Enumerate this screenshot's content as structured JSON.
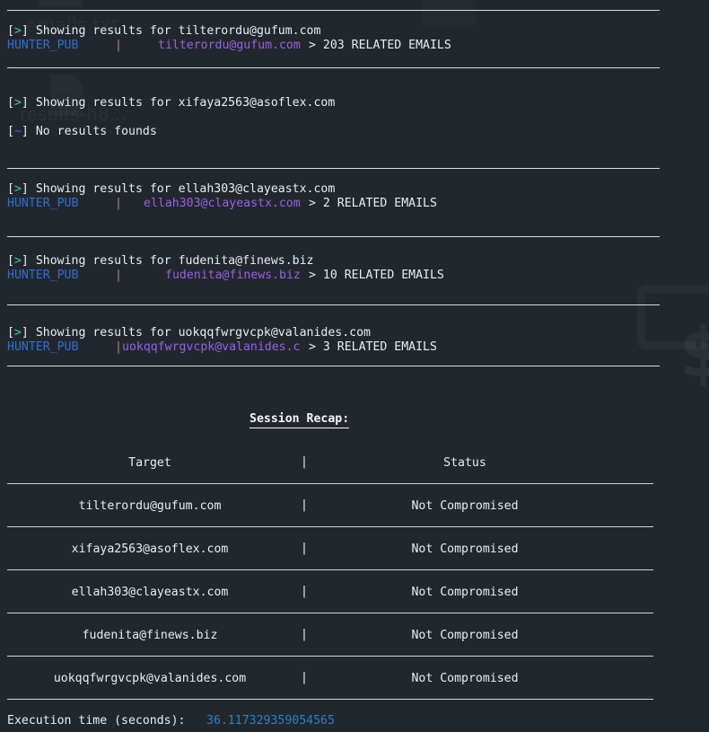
{
  "terminal": {
    "background_color": "#22272e",
    "foreground_color": "#e9edf2",
    "accent_green": "#2fce9f",
    "accent_blue": "#2f6fd0",
    "accent_purple": "#9a5fe2",
    "accent_lightblue": "#2583c6",
    "rule_color": "#d8dde5"
  },
  "watermarks": {
    "file_label_top": "emails.txt",
    "file_label_mid": "results-h8...",
    "dollar_glyph": "$"
  },
  "prompts": {
    "result_marker_open": "[",
    "result_marker_arrow": ">",
    "result_marker_close": "]",
    "empty_marker_open": "[",
    "empty_marker_tilde": "~",
    "empty_marker_close": "]",
    "showing_prefix": "Showing results for ",
    "no_results": "No results founds",
    "source_label": "HUNTER_PUB",
    "divider": "|",
    "gt": ">",
    "related_suffix": "RELATED EMAILS"
  },
  "results": [
    {
      "target": "tilterordu@gufum.com",
      "source": "HUNTER_PUB",
      "email_display": "tilterordu@gufum.com",
      "count": "203",
      "related_text": "> 203 RELATED EMAILS",
      "found": true
    },
    {
      "target": "xifaya2563@asoflex.com",
      "source": "",
      "email_display": "",
      "count": "0",
      "related_text": "",
      "found": false
    },
    {
      "target": "ellah303@clayeastx.com",
      "source": "HUNTER_PUB",
      "email_display": "ellah303@clayeastx.com",
      "count": "2",
      "related_text": "> 2 RELATED EMAILS",
      "found": true
    },
    {
      "target": "fudenita@finews.biz",
      "source": "HUNTER_PUB",
      "email_display": "fudenita@finews.biz",
      "count": "10",
      "related_text": "> 10 RELATED EMAILS",
      "found": true
    },
    {
      "target": "uokqqfwrgvcpk@valanides.com",
      "source": "HUNTER_PUB",
      "email_display": "uokqqfwrgvcpk@valanides.c",
      "count": "3",
      "related_text": "> 3 RELATED EMAILS",
      "found": true
    }
  ],
  "recap": {
    "title": "Session Recap:",
    "columns": [
      "Target",
      "Status"
    ],
    "column_divider": "|",
    "rows": [
      {
        "target": "tilterordu@gufum.com",
        "divider": "|",
        "status": "Not Compromised"
      },
      {
        "target": "xifaya2563@asoflex.com",
        "divider": "|",
        "status": "Not Compromised"
      },
      {
        "target": "ellah303@clayeastx.com",
        "divider": "|",
        "status": "Not Compromised"
      },
      {
        "target": "fudenita@finews.biz",
        "divider": "|",
        "status": "Not Compromised"
      },
      {
        "target": "uokqqfwrgvcpk@valanides.com",
        "divider": "|",
        "status": "Not Compromised"
      }
    ]
  },
  "footer": {
    "execution_label": "Execution time (seconds):",
    "execution_value": "36.117329359054565"
  }
}
